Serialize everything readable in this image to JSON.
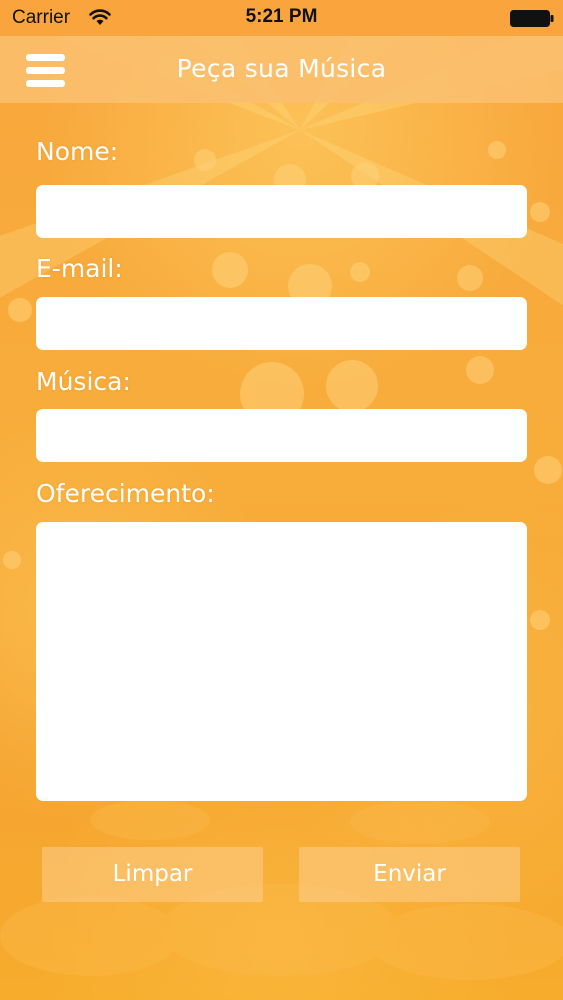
{
  "status_bar": {
    "carrier": "Carrier",
    "time": "5:21 PM",
    "wifi_icon": "wifi-icon",
    "battery_icon": "battery-icon"
  },
  "nav": {
    "title": "Peça sua Música",
    "menu_icon": "hamburger-menu-icon"
  },
  "form": {
    "nome": {
      "label": "Nome:",
      "value": ""
    },
    "email": {
      "label": "E-mail:",
      "value": ""
    },
    "musica": {
      "label": "Música:",
      "value": ""
    },
    "oferecimento": {
      "label": "Oferecimento:",
      "value": ""
    }
  },
  "buttons": {
    "clear_label": "Limpar",
    "send_label": "Enviar"
  },
  "colors": {
    "background": "#f8a83a",
    "nav_bar": "#fbbf6e",
    "text": "#ffffff"
  }
}
